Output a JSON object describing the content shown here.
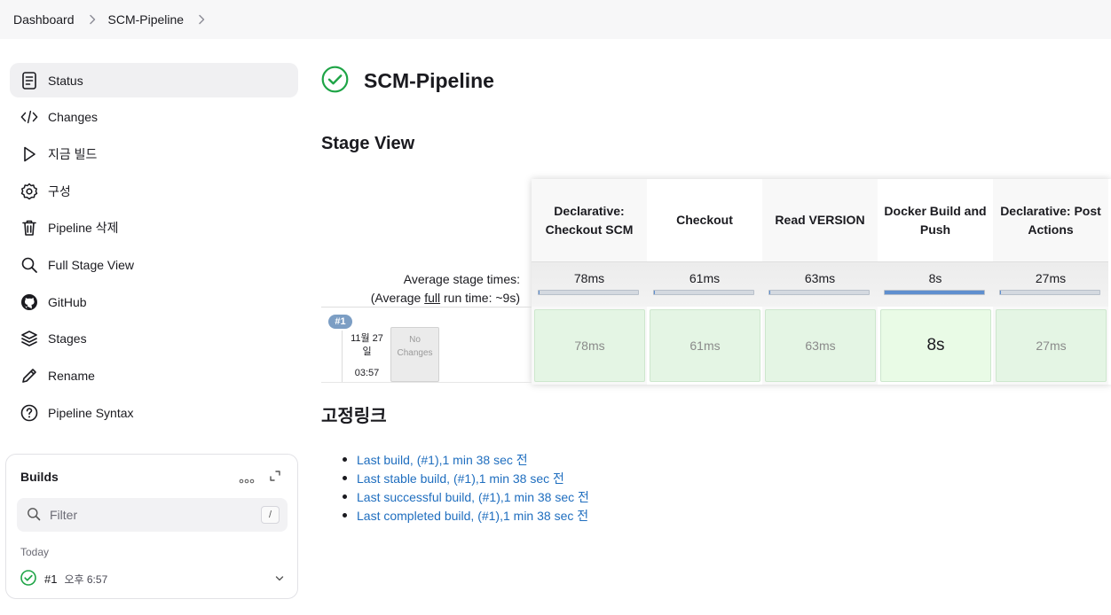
{
  "breadcrumb": {
    "items": [
      "Dashboard",
      "SCM-Pipeline"
    ]
  },
  "sidebar": {
    "items": [
      {
        "label": "Status",
        "icon": "document-icon",
        "active": true
      },
      {
        "label": "Changes",
        "icon": "code-icon"
      },
      {
        "label": "지금 빌드",
        "icon": "play-icon"
      },
      {
        "label": "구성",
        "icon": "gear-icon"
      },
      {
        "label": "Pipeline 삭제",
        "icon": "trash-icon"
      },
      {
        "label": "Full Stage View",
        "icon": "search-icon"
      },
      {
        "label": "GitHub",
        "icon": "github-icon"
      },
      {
        "label": "Stages",
        "icon": "layers-icon"
      },
      {
        "label": "Rename",
        "icon": "pencil-icon"
      },
      {
        "label": "Pipeline Syntax",
        "icon": "help-icon"
      }
    ]
  },
  "builds": {
    "title": "Builds",
    "filter_placeholder": "Filter",
    "filter_shortcut": "/",
    "group_label": "Today",
    "items": [
      {
        "number": "#1",
        "time": "오후 6:57",
        "status": "success"
      }
    ]
  },
  "main": {
    "title": "SCM-Pipeline",
    "status_color": "#1ea446",
    "stage_view": {
      "heading": "Stage View",
      "avg_label_line1": "Average stage times:",
      "avg_label_line2_prefix": "(Average ",
      "avg_label_line2_link": "full",
      "avg_label_line2_suffix": " run time: ~9s)",
      "stages": [
        {
          "name": "Declarative: Checkout SCM",
          "avg": "78ms",
          "avg_fraction": 0.01,
          "run_value": "78ms"
        },
        {
          "name": "Checkout",
          "avg": "61ms",
          "avg_fraction": 0.01,
          "run_value": "61ms"
        },
        {
          "name": "Read VERSION",
          "avg": "63ms",
          "avg_fraction": 0.01,
          "run_value": "63ms"
        },
        {
          "name": "Docker Build and Push",
          "avg": "8s",
          "avg_fraction": 1.0,
          "run_value": "8s"
        },
        {
          "name": "Declarative: Post Actions",
          "avg": "27ms",
          "avg_fraction": 0.01,
          "run_value": "27ms"
        }
      ],
      "run": {
        "badge": "#1",
        "date_line1": "11월 27",
        "date_line2": "일",
        "time": "03:57",
        "changes_line1": "No",
        "changes_line2": "Changes"
      }
    },
    "permalinks": {
      "heading": "고정링크",
      "items": [
        "Last build, (#1),1 min 38 sec 전",
        "Last stable build, (#1),1 min 38 sec 전",
        "Last successful build, (#1),1 min 38 sec 전",
        "Last completed build, (#1),1 min 38 sec 전"
      ]
    }
  }
}
